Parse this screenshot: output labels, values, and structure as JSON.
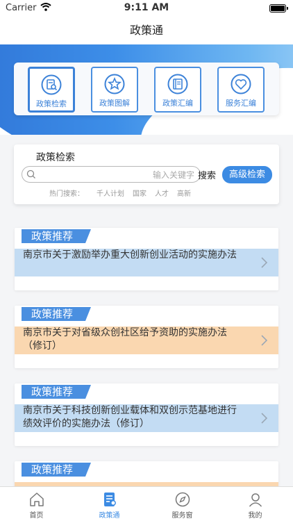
{
  "status": {
    "carrier": "Carrier",
    "time": "9:11 AM"
  },
  "nav": {
    "title": "政策通"
  },
  "quick": [
    {
      "label": "政策检索",
      "icon": "doc-search-icon",
      "active": true
    },
    {
      "label": "政策图解",
      "icon": "star-circle-icon",
      "active": false
    },
    {
      "label": "政策汇编",
      "icon": "book-icon",
      "active": false
    },
    {
      "label": "服务汇编",
      "icon": "heart-circle-icon",
      "active": false
    }
  ],
  "search": {
    "title": "政策检索",
    "placeholder": "输入关键字",
    "search_label": "搜索",
    "advanced_label": "高级检索",
    "hot_label": "热门搜索：",
    "hot_terms": [
      "千人计划",
      "国家",
      "人才",
      "高新"
    ]
  },
  "policies": [
    {
      "badge": "政策推荐",
      "title": "南京市关于激励举办重大创新创业活动的实施办法",
      "color": "blue"
    },
    {
      "badge": "政策推荐",
      "title": "南京市关于对省级众创社区给予资助的实施办法（修订）",
      "color": "orange"
    },
    {
      "badge": "政策推荐",
      "title": "南京市关于科技创新创业载体和双创示范基地进行绩效评价的实施办法（修订）",
      "color": "blue"
    },
    {
      "badge": "政策推荐",
      "title": "",
      "color": "orange"
    }
  ],
  "tabs": [
    {
      "label": "首页",
      "icon": "home-icon",
      "active": false
    },
    {
      "label": "政策通",
      "icon": "policy-doc-icon",
      "active": true
    },
    {
      "label": "服务窗",
      "icon": "compass-icon",
      "active": false
    },
    {
      "label": "我的",
      "icon": "user-icon",
      "active": false
    }
  ],
  "colors": {
    "accent": "#3c8be3",
    "blue_row": "#c3dcf3",
    "orange_row": "#fad7b0"
  }
}
